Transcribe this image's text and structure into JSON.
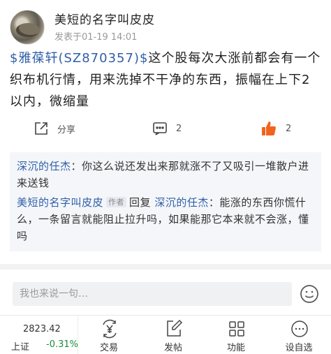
{
  "post": {
    "author": "美短的名字叫皮皮",
    "time": "发表于01-19 14:01",
    "stock_tag": "$雅葆轩(SZ870357)$",
    "body": "这个股每次大涨前都会有一个织布机行情，用来洗掉不干净的东西，振幅在上下2以内，微缩量"
  },
  "actions": {
    "share_label": "分享",
    "comment_count": "2",
    "like_count": "2"
  },
  "comments": [
    {
      "name": "深沉的任杰",
      "text": "：你这么说还发出来那就涨不了又吸引一堆散户进来送钱"
    },
    {
      "name": "美短的名字叫皮皮",
      "badge": "作者",
      "reply_word": "回复",
      "reply_to": "深沉的任杰",
      "text": "：能涨的东西你慌什么，一条留言就能阻止拉升吗，如果能那它本来就不会涨，懂吗"
    }
  ],
  "reply": {
    "placeholder": "我也来说一句…"
  },
  "bottom": {
    "index_value": "2823.42",
    "index_name": "上证",
    "index_change": "-0.31%",
    "nav": [
      {
        "label": "交易",
        "icon": "yuan-exchange-icon"
      },
      {
        "label": "发帖",
        "icon": "edit-icon"
      },
      {
        "label": "功能",
        "icon": "grid-icon"
      },
      {
        "label": "设自选",
        "icon": "more-icon"
      }
    ]
  },
  "colors": {
    "link_blue": "#2f5fa8",
    "like_orange": "#f0641e",
    "index_down": "#1a8f3c"
  }
}
